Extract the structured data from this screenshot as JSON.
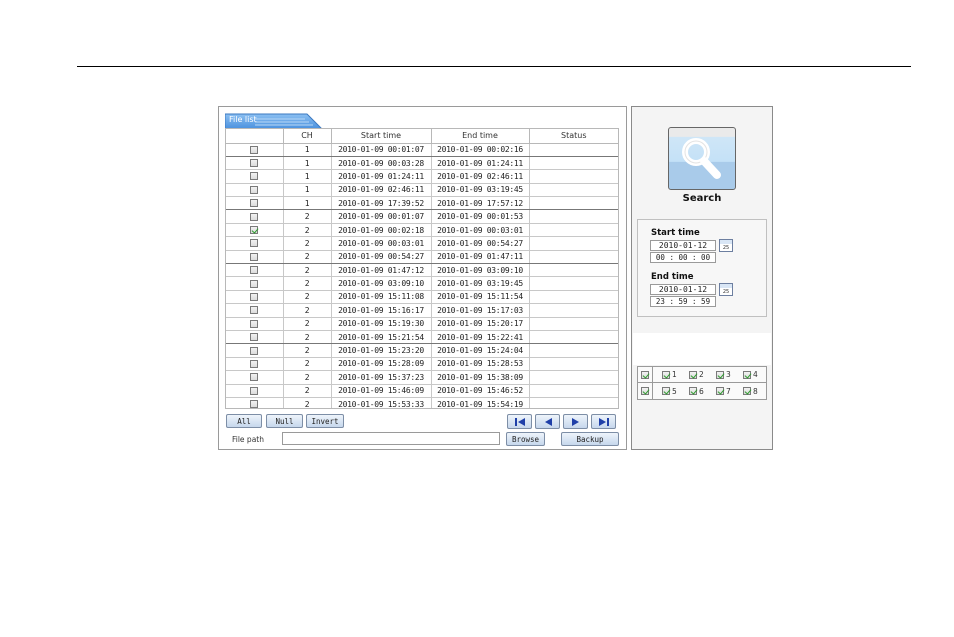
{
  "file_list": {
    "tab_label": "File list",
    "columns": [
      "",
      "CH",
      "Start time",
      "End time",
      "Status"
    ],
    "rows": [
      {
        "checked": false,
        "ch": "1",
        "start": "2010-01-09 00:01:07",
        "end": "2010-01-09 00:02:16",
        "status": ""
      },
      {
        "checked": false,
        "ch": "1",
        "start": "2010-01-09 00:03:28",
        "end": "2010-01-09 01:24:11",
        "status": ""
      },
      {
        "checked": false,
        "ch": "1",
        "start": "2010-01-09 01:24:11",
        "end": "2010-01-09 02:46:11",
        "status": ""
      },
      {
        "checked": false,
        "ch": "1",
        "start": "2010-01-09 02:46:11",
        "end": "2010-01-09 03:19:45",
        "status": ""
      },
      {
        "checked": false,
        "ch": "1",
        "start": "2010-01-09 17:39:52",
        "end": "2010-01-09 17:57:12",
        "status": ""
      },
      {
        "checked": false,
        "ch": "2",
        "start": "2010-01-09 00:01:07",
        "end": "2010-01-09 00:01:53",
        "status": ""
      },
      {
        "checked": true,
        "ch": "2",
        "start": "2010-01-09 00:02:18",
        "end": "2010-01-09 00:03:01",
        "status": ""
      },
      {
        "checked": false,
        "ch": "2",
        "start": "2010-01-09 00:03:01",
        "end": "2010-01-09 00:54:27",
        "status": ""
      },
      {
        "checked": false,
        "ch": "2",
        "start": "2010-01-09 00:54:27",
        "end": "2010-01-09 01:47:11",
        "status": ""
      },
      {
        "checked": false,
        "ch": "2",
        "start": "2010-01-09 01:47:12",
        "end": "2010-01-09 03:09:10",
        "status": ""
      },
      {
        "checked": false,
        "ch": "2",
        "start": "2010-01-09 03:09:10",
        "end": "2010-01-09 03:19:45",
        "status": ""
      },
      {
        "checked": false,
        "ch": "2",
        "start": "2010-01-09 15:11:08",
        "end": "2010-01-09 15:11:54",
        "status": ""
      },
      {
        "checked": false,
        "ch": "2",
        "start": "2010-01-09 15:16:17",
        "end": "2010-01-09 15:17:03",
        "status": ""
      },
      {
        "checked": false,
        "ch": "2",
        "start": "2010-01-09 15:19:30",
        "end": "2010-01-09 15:20:17",
        "status": ""
      },
      {
        "checked": false,
        "ch": "2",
        "start": "2010-01-09 15:21:54",
        "end": "2010-01-09 15:22:41",
        "status": ""
      },
      {
        "checked": false,
        "ch": "2",
        "start": "2010-01-09 15:23:20",
        "end": "2010-01-09 15:24:04",
        "status": ""
      },
      {
        "checked": false,
        "ch": "2",
        "start": "2010-01-09 15:28:09",
        "end": "2010-01-09 15:28:53",
        "status": ""
      },
      {
        "checked": false,
        "ch": "2",
        "start": "2010-01-09 15:37:23",
        "end": "2010-01-09 15:38:09",
        "status": ""
      },
      {
        "checked": false,
        "ch": "2",
        "start": "2010-01-09 15:46:09",
        "end": "2010-01-09 15:46:52",
        "status": ""
      },
      {
        "checked": false,
        "ch": "2",
        "start": "2010-01-09 15:53:33",
        "end": "2010-01-09 15:54:19",
        "status": ""
      }
    ],
    "dark_separator_after": [
      0,
      4,
      8,
      14
    ]
  },
  "buttons": {
    "all": "All",
    "null": "Null",
    "invert": "Invert",
    "browse": "Browse",
    "backup": "Backup"
  },
  "nav": {
    "first_icon": "skip-first-icon",
    "prev_icon": "prev-icon",
    "next_icon": "next-icon",
    "last_icon": "skip-last-icon"
  },
  "file_path": {
    "label": "File path",
    "value": ""
  },
  "search": {
    "label": "Search",
    "icon": "magnifier-icon"
  },
  "start_time": {
    "label": "Start time",
    "date": "2010-01-12",
    "time": "00 : 00 : 00",
    "calendar_label": "25"
  },
  "end_time": {
    "label": "End time",
    "date": "2010-01-12",
    "time": "23 : 59 : 59",
    "calendar_label": "25"
  },
  "channels": {
    "row1_all_checked": true,
    "row2_all_checked": true,
    "items": [
      {
        "label": "1",
        "checked": true
      },
      {
        "label": "2",
        "checked": true
      },
      {
        "label": "3",
        "checked": true
      },
      {
        "label": "4",
        "checked": true
      },
      {
        "label": "5",
        "checked": true
      },
      {
        "label": "6",
        "checked": true
      },
      {
        "label": "7",
        "checked": true
      },
      {
        "label": "8",
        "checked": true
      }
    ]
  },
  "colors": {
    "tab_blue": "#5aa0e8",
    "button_top": "#eef4fb",
    "button_bottom": "#c6d7ec",
    "check_green": "#2f9c2f"
  }
}
